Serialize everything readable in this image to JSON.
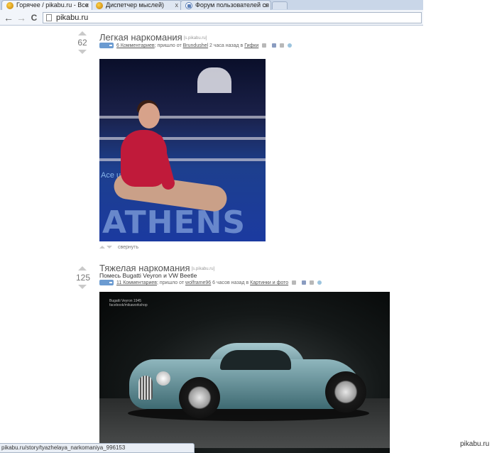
{
  "browser": {
    "tabs": [
      {
        "title": "Горячее / pikabu.ru - Все",
        "active": true
      },
      {
        "title": "Диспетчер мыслей)",
        "active": false
      },
      {
        "title": "Форум пользователей ся",
        "active": false
      }
    ],
    "close_glyph": "x",
    "url": "pikabu.ru",
    "back_glyph": "←",
    "forward_glyph": "→",
    "reload_glyph": "C"
  },
  "stories": [
    {
      "rating": "62",
      "title": "Легкая наркомания",
      "source": "[s.pikabu.ru]",
      "subtitle": "",
      "comments": "6 Комментариев",
      "meta_mid": "; пришло от",
      "author": "Brundushel",
      "time": "2 часа назад в",
      "category": "Гифки",
      "image_text": {
        "athens": "ATHENS 2",
        "ace": "Ace           udes"
      },
      "collapse": "свернуть"
    },
    {
      "rating": "125",
      "title": "Тяжелая наркомания",
      "source": "[s.pikabu.ru]",
      "subtitle": "Помесь Bugatti Veyron и VW Beetle",
      "comments": "11 Комментариев",
      "meta_mid": "; пришло от",
      "author": "wolframe96",
      "time": "6 часов назад в",
      "category": "Картинки и фото",
      "image_text": {
        "caption": "Bugatti Veyron 1945",
        "caption2": "facebook/mikaworkshop"
      }
    }
  ],
  "status": "pikabu.ru/story/tyazhelaya_narkomaniya_996153",
  "watermark": "pikabu.ru",
  "colors": {
    "like": "#6b9bd1",
    "accent": "#c01a3a"
  }
}
